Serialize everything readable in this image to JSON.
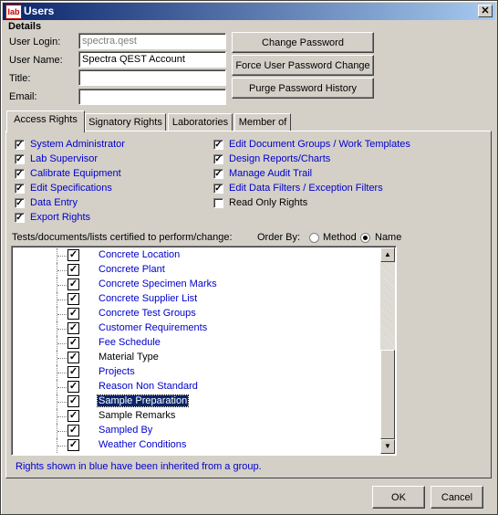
{
  "window": {
    "title": "Users",
    "app_icon_text": "lab"
  },
  "details": {
    "heading": "Details",
    "user_login_label": "User Login:",
    "user_login_value": "spectra.qest",
    "user_name_label": "User Name:",
    "user_name_value": "Spectra QEST Account",
    "title_label": "Title:",
    "title_value": "",
    "email_label": "Email:",
    "email_value": ""
  },
  "buttons": {
    "change_password": "Change Password",
    "force_change": "Force User Password Change",
    "purge_history": "Purge Password History",
    "ok": "OK",
    "cancel": "Cancel"
  },
  "tabs": [
    "Access Rights",
    "Signatory Rights",
    "Laboratories",
    "Member of"
  ],
  "rights_left": [
    {
      "label": "System Administrator",
      "checked": true,
      "inherited": true
    },
    {
      "label": "Lab Supervisor",
      "checked": true,
      "inherited": true
    },
    {
      "label": "Calibrate Equipment",
      "checked": true,
      "inherited": true
    },
    {
      "label": "Edit Specifications",
      "checked": true,
      "inherited": true
    },
    {
      "label": "Data Entry",
      "checked": true,
      "inherited": true
    },
    {
      "label": "Export Rights",
      "checked": true,
      "inherited": true
    }
  ],
  "rights_right": [
    {
      "label": "Edit Document Groups / Work Templates",
      "checked": true,
      "inherited": true
    },
    {
      "label": "Design Reports/Charts",
      "checked": true,
      "inherited": true
    },
    {
      "label": "Manage Audit Trail",
      "checked": true,
      "inherited": true
    },
    {
      "label": "Edit Data Filters / Exception Filters",
      "checked": true,
      "inherited": true
    },
    {
      "label": "Read Only Rights",
      "checked": false,
      "inherited": false
    }
  ],
  "tests_label": "Tests/documents/lists certified to perform/change:",
  "order_by": {
    "label": "Order By:",
    "options": [
      "Method",
      "Name"
    ],
    "selected": "Name"
  },
  "tree_items": [
    {
      "label": "Concrete Location",
      "inherited": true,
      "selected": false
    },
    {
      "label": "Concrete Plant",
      "inherited": true,
      "selected": false
    },
    {
      "label": "Concrete Specimen Marks",
      "inherited": true,
      "selected": false
    },
    {
      "label": "Concrete Supplier List",
      "inherited": true,
      "selected": false
    },
    {
      "label": "Concrete Test Groups",
      "inherited": true,
      "selected": false
    },
    {
      "label": "Customer Requirements",
      "inherited": true,
      "selected": false
    },
    {
      "label": "Fee Schedule",
      "inherited": true,
      "selected": false
    },
    {
      "label": "Material Type",
      "inherited": false,
      "selected": false
    },
    {
      "label": "Projects",
      "inherited": true,
      "selected": false
    },
    {
      "label": "Reason Non Standard",
      "inherited": true,
      "selected": false
    },
    {
      "label": "Sample Preparation",
      "inherited": false,
      "selected": true
    },
    {
      "label": "Sample Remarks",
      "inherited": false,
      "selected": false
    },
    {
      "label": "Sampled By",
      "inherited": true,
      "selected": false
    },
    {
      "label": "Weather Conditions",
      "inherited": true,
      "selected": false
    }
  ],
  "footer_note": "Rights shown in blue have been inherited from a group.",
  "colors": {
    "inherited": "#0000cc",
    "titlebar": "#0a246a",
    "selection": "#0a246a"
  }
}
